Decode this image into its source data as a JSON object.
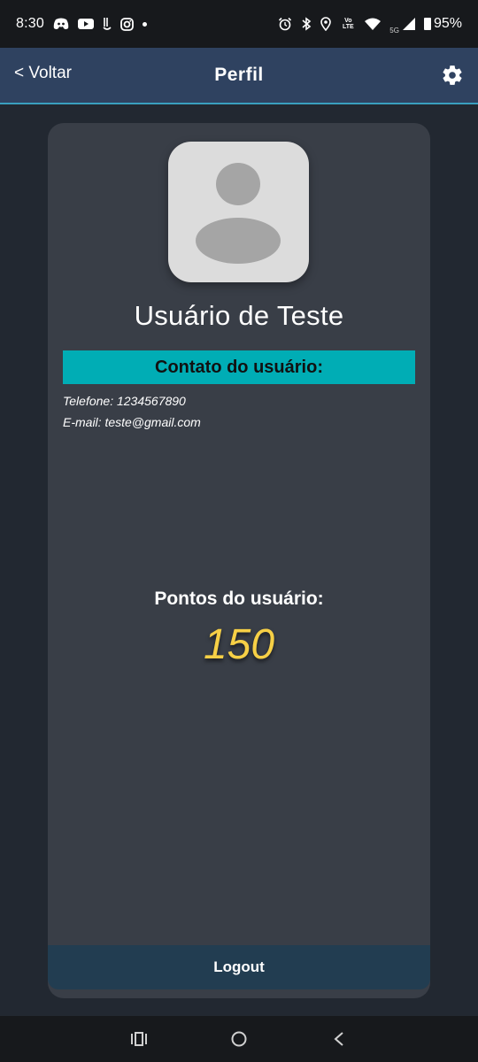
{
  "status_bar": {
    "time": "8:30",
    "network": "5G",
    "volte": "Vo LTE",
    "battery": "95%",
    "left_icons": [
      "discord-icon",
      "youtube-icon",
      "app-icon",
      "instagram-icon",
      "dot-icon"
    ],
    "right_icons": [
      "alarm-icon",
      "bluetooth-icon",
      "location-icon",
      "volte-icon",
      "wifi-icon",
      "signal-icon",
      "battery-icon"
    ]
  },
  "header": {
    "back_label": "< Voltar",
    "title": "Perfil",
    "settings_icon": "gear-icon"
  },
  "profile": {
    "name": "Usuário de Teste",
    "contact_title": "Contato do usuário:",
    "phone": "Telefone: 1234567890",
    "email": "E-mail: teste@gmail.com",
    "points_label": "Pontos do usuário:",
    "points_value": "150",
    "logout_label": "Logout"
  },
  "nav_bar": {
    "icons": [
      "recents-icon",
      "home-icon",
      "back-icon"
    ]
  },
  "colors": {
    "background": "#222831",
    "header": "#2f4260",
    "card": "#393e47",
    "accent": "#00adb5",
    "points": "#f7d046",
    "logout": "#223d51"
  }
}
